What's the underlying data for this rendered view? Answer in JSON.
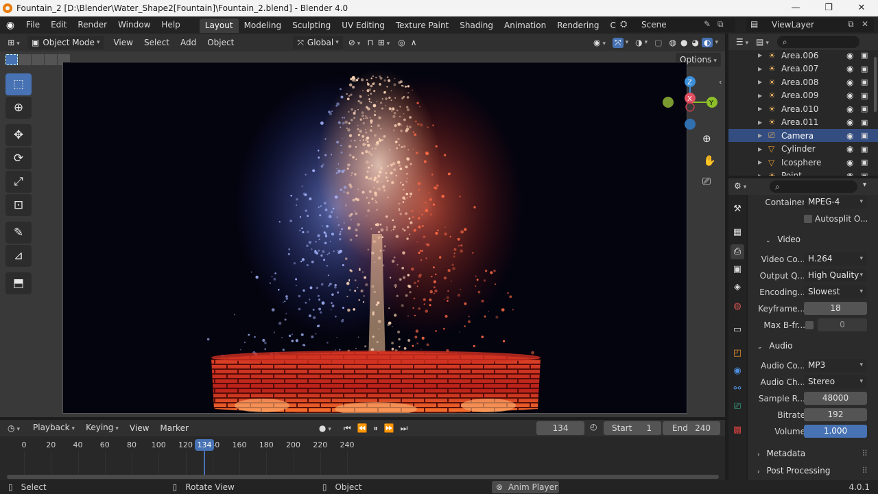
{
  "window": {
    "title": "Fountain_2 [D:\\Blender\\Water_Shape2[Fountain]\\Fountain_2.blend] - Blender 4.0",
    "minimize": "—",
    "maximize": "❐",
    "close": "✕"
  },
  "menu": [
    "File",
    "Edit",
    "Render",
    "Window",
    "Help"
  ],
  "workspaces": [
    "Layout",
    "Modeling",
    "Sculpting",
    "UV Editing",
    "Texture Paint",
    "Shading",
    "Animation",
    "Rendering",
    "Compositin"
  ],
  "active_workspace": "Layout",
  "scene": "Scene",
  "view_layer": "ViewLayer",
  "viewport_header": {
    "mode": "Object Mode",
    "menus": [
      "View",
      "Select",
      "Add",
      "Object"
    ],
    "orientation": "Global",
    "options": "Options"
  },
  "timeline": {
    "menus": [
      "Playback",
      "Keying",
      "View",
      "Marker"
    ],
    "current_frame": "134",
    "start_label": "Start",
    "start": "1",
    "end_label": "End",
    "end": "240",
    "ticks": [
      "0",
      "20",
      "40",
      "60",
      "80",
      "100",
      "120",
      "140",
      "160",
      "180",
      "200",
      "220",
      "240"
    ]
  },
  "outliner": {
    "items": [
      {
        "name": "Area.006",
        "icon": "light-icon",
        "selected": false
      },
      {
        "name": "Area.007",
        "icon": "light-icon",
        "selected": false
      },
      {
        "name": "Area.008",
        "icon": "light-icon",
        "selected": false
      },
      {
        "name": "Area.009",
        "icon": "light-icon",
        "selected": false
      },
      {
        "name": "Area.010",
        "icon": "light-icon",
        "selected": false
      },
      {
        "name": "Area.011",
        "icon": "light-icon",
        "selected": false
      },
      {
        "name": "Camera",
        "icon": "camera-icon",
        "selected": true
      },
      {
        "name": "Cylinder",
        "icon": "mesh-icon",
        "selected": false
      },
      {
        "name": "Icosphere",
        "icon": "mesh-icon",
        "selected": false
      },
      {
        "name": "Point",
        "icon": "light-icon",
        "selected": false
      }
    ]
  },
  "properties": {
    "container_label": "Container",
    "container": "MPEG-4",
    "autosplit": "Autosplit O...",
    "video_section": "Video",
    "video_codec_label": "Video Co...",
    "video_codec": "H.264",
    "output_quality_label": "Output Q...",
    "output_quality": "High Quality",
    "encoding_label": "Encoding...",
    "encoding": "Slowest",
    "keyframe_label": "Keyframe...",
    "keyframe": "18",
    "max_bframes_label": "Max B-fr...",
    "max_bframes": "0",
    "audio_section": "Audio",
    "audio_codec_label": "Audio Co...",
    "audio_codec": "MP3",
    "audio_channels_label": "Audio Ch...",
    "audio_channels": "Stereo",
    "sample_rate_label": "Sample R...",
    "sample_rate": "48000",
    "bitrate_label": "Bitrate",
    "bitrate": "192",
    "volume_label": "Volume",
    "volume": "1.000",
    "metadata_section": "Metadata",
    "post_processing_section": "Post Processing"
  },
  "status": {
    "select": "Select",
    "rotate_view": "Rotate View",
    "object": "Object",
    "anim_player": "Anim Player",
    "version": "4.0.1"
  },
  "colors": {
    "accent": "#4772b3",
    "selection": "#334d80",
    "brick": "#c8281e"
  }
}
